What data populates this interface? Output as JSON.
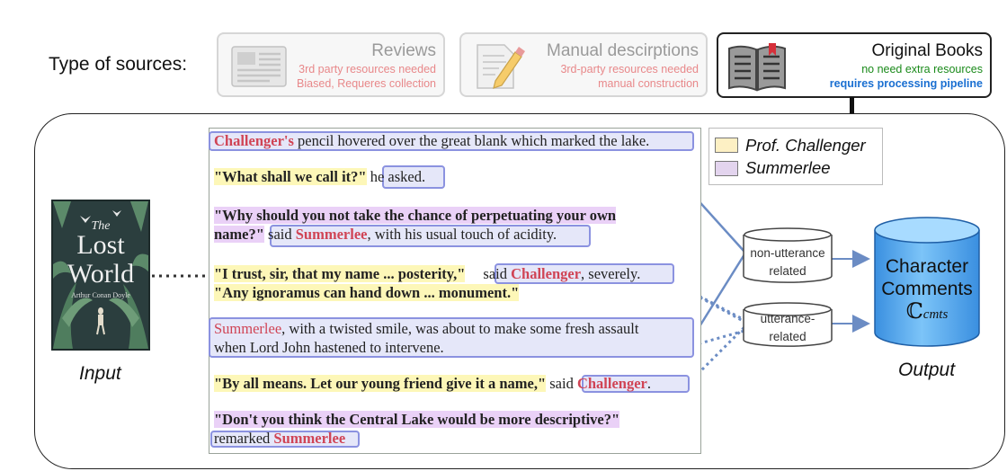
{
  "sources": {
    "label": "Type of sources:",
    "reviews": {
      "title": "Reviews",
      "line1": "3rd party resources needed",
      "line2": "Biased, Requeres collection"
    },
    "manual": {
      "title": "Manual descirptions",
      "line1": "3rd-party resources needed",
      "line2": "manual construction"
    },
    "books": {
      "title": "Original Books",
      "line1": "no need extra resources",
      "line2": "requires processing pipeline"
    }
  },
  "cover": {
    "word1": "The",
    "word2": "Lost",
    "word3": "World",
    "author": "Arthur Conan Doyle"
  },
  "input_label": "Input",
  "output_label": "Output",
  "text": {
    "l1_name": "Challenger's",
    "l1_rest": " pencil hovered over the great blank which marked the lake.",
    "l2_quote": "\"What shall we call it?\"",
    "l2_rest": "he asked.",
    "l3_quote": "\"Why should you not take the chance of perpetuating your own",
    "l4_quote": "name?\"",
    "l4_said": "said ",
    "l4_name": "Summerlee",
    "l4_rest": ", with his usual touch of acidity.",
    "l5_quote": "\"I trust, sir, that my name ... posterity,\"",
    "l5_said": "said ",
    "l5_name": "Challenger",
    "l5_rest": ", severely.",
    "l6_quote": "\"Any ignoramus can hand down ... monument.\"",
    "l7_name": "Summerlee",
    "l7_rest": ", with a twisted smile, was about to make some fresh assault",
    "l8": "when Lord John hastened to intervene.",
    "l9_quote": "\"By all means.  Let our young friend give it a name,\"",
    "l9_said": "said ",
    "l9_name": "Challenger",
    "l9_dot": ".",
    "l10_quote": "\"Don't you think the Central Lake would be more descriptive?\"",
    "l11_said": "remarked ",
    "l11_name": "Summerlee"
  },
  "legend": [
    {
      "label": "Prof. Challenger",
      "color": "#fdf0c4"
    },
    {
      "label": "Summerlee",
      "color": "#e3d4ee"
    }
  ],
  "categories": {
    "non_utt_1": "non-utterance",
    "non_utt_2": "related",
    "utt_1": "utterance-",
    "utt_2": "related"
  },
  "database": {
    "line1": "Character",
    "line2": "Comments",
    "symbol": "ℂ",
    "sub": "cmts"
  },
  "colors": {
    "name_red": "#d04455",
    "quote_yellow": "#fdf7b8",
    "quote_purple": "#ead1f7",
    "box_blue": "#8b92e0",
    "arrow_blue": "#6b8cc4",
    "db_blue": "#4a9fe8",
    "green": "#1a8a1a",
    "link_blue": "#1a6fd1"
  }
}
